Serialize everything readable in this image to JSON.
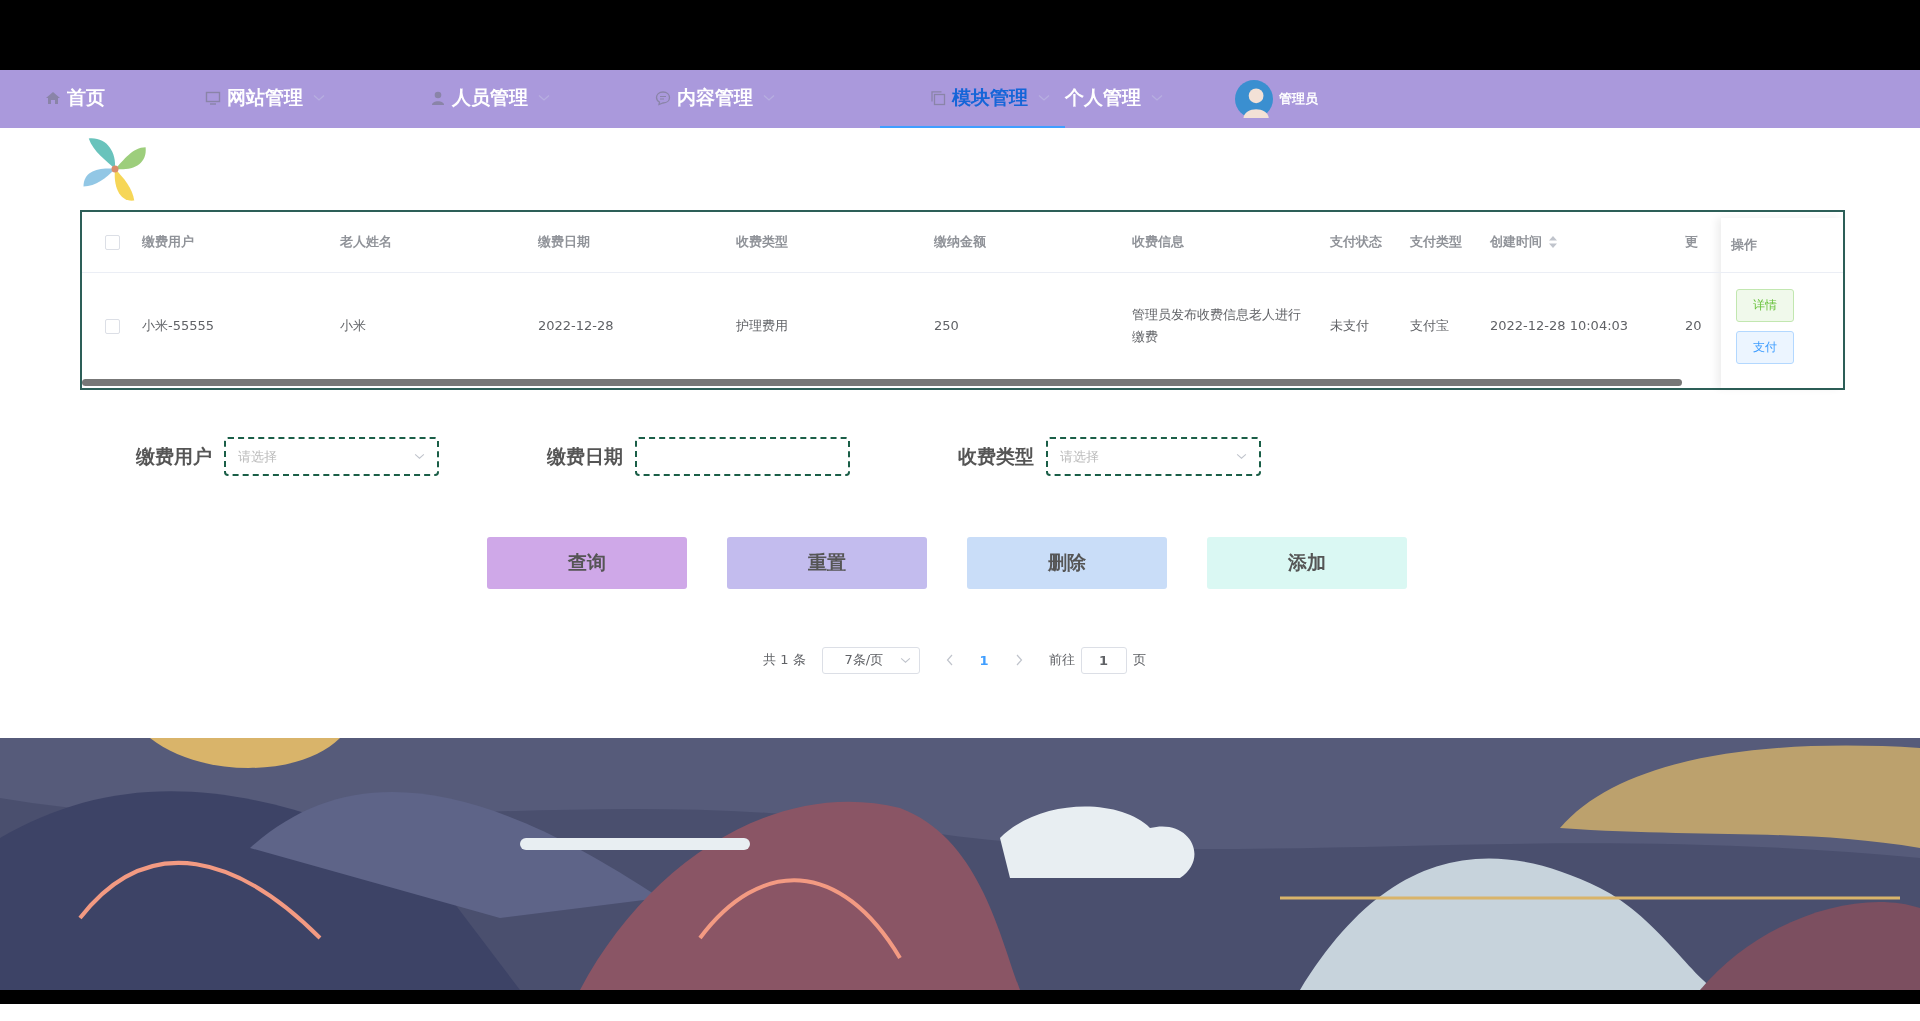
{
  "nav": {
    "items": [
      {
        "label": "首页",
        "dropdown": false,
        "selected": false
      },
      {
        "label": "网站管理",
        "dropdown": true,
        "selected": false
      },
      {
        "label": "人员管理",
        "dropdown": true,
        "selected": false
      },
      {
        "label": "内容管理",
        "dropdown": true,
        "selected": false
      },
      {
        "label": "模块管理",
        "dropdown": true,
        "selected": true
      },
      {
        "label": "个人管理",
        "dropdown": true,
        "selected": false
      }
    ],
    "user": {
      "name": "管理员"
    }
  },
  "table": {
    "header_checked": false,
    "columns": [
      {
        "label": "缴费用户",
        "sortable": false
      },
      {
        "label": "老人姓名",
        "sortable": false
      },
      {
        "label": "缴费日期",
        "sortable": false
      },
      {
        "label": "收费类型",
        "sortable": false
      },
      {
        "label": "缴纳金额",
        "sortable": false
      },
      {
        "label": "收费信息",
        "sortable": false
      },
      {
        "label": "支付状态",
        "sortable": false
      },
      {
        "label": "支付类型",
        "sortable": false
      },
      {
        "label": "创建时间",
        "sortable": true
      },
      {
        "label": "更",
        "sortable": false
      }
    ],
    "action_column": "操作",
    "rows": [
      {
        "checked": false,
        "cells": [
          "小米-55555",
          "小米",
          "2022-12-28",
          "护理费用",
          "250",
          "管理员发布收费信息老人进行缴费",
          "未支付",
          "支付宝",
          "2022-12-28 10:04:03",
          "20"
        ],
        "actions": [
          {
            "label": "详情",
            "kind": "detail"
          },
          {
            "label": "支付",
            "kind": "pay"
          }
        ]
      }
    ]
  },
  "filters": [
    {
      "label": "缴费用户",
      "kind": "select",
      "placeholder": "请选择"
    },
    {
      "label": "缴费日期",
      "kind": "date"
    },
    {
      "label": "收费类型",
      "kind": "select",
      "placeholder": "请选择"
    }
  ],
  "buttons": [
    {
      "label": "查询",
      "kind": "query"
    },
    {
      "label": "重置",
      "kind": "reset"
    },
    {
      "label": "删除",
      "kind": "delete"
    },
    {
      "label": "添加",
      "kind": "add"
    }
  ],
  "pagination": {
    "total": "共 1 条",
    "page_size": "7条/页",
    "pages": [
      {
        "label": "1",
        "selected": true
      }
    ],
    "goto_label": "前往",
    "goto_value": "1",
    "page_suffix": "页"
  }
}
